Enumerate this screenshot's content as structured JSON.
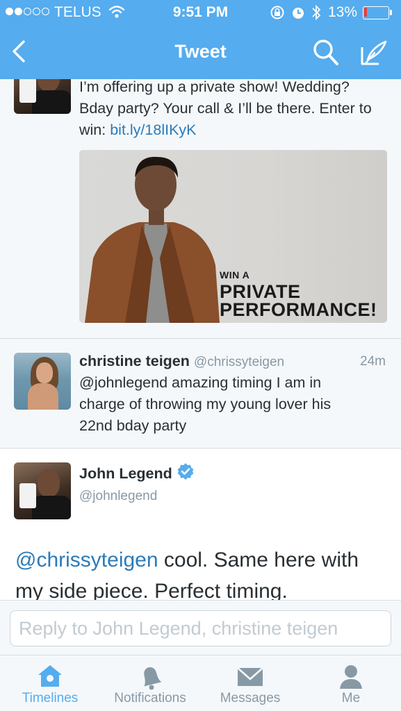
{
  "status_bar": {
    "carrier": "TELUS",
    "time": "9:51 PM",
    "battery_percent": "13%",
    "battery_level": 0.13,
    "signal_bars_filled": 2,
    "signal_bars_total": 5
  },
  "nav": {
    "title": "Tweet",
    "icons": [
      "back-chevron-icon",
      "search-icon",
      "compose-icon"
    ]
  },
  "tweets": [
    {
      "text_before_link": "I’m offering up a private show! Wedding? Bday party? Your call & I’ll be there. Enter to win: ",
      "link": "bit.ly/18lIKyK",
      "media": {
        "line1": "WIN A",
        "line2": "PRIVATE",
        "line3": "PERFORMANCE!"
      }
    },
    {
      "name": "christine teigen",
      "handle": "@chrissyteigen",
      "time": "24m",
      "text": "@johnlegend amazing timing I am in charge of throwing my young lover his 22nd bday party"
    },
    {
      "name": "John Legend",
      "handle": "@johnlegend",
      "mention": "@chrissyteigen",
      "text": " cool. Same here with my side piece. Perfect timing."
    }
  ],
  "reply": {
    "placeholder": "Reply to John Legend, christine teigen"
  },
  "tabs": [
    {
      "label": "Timelines",
      "icon": "home-icon",
      "active": true
    },
    {
      "label": "Notifications",
      "icon": "bell-icon",
      "active": false
    },
    {
      "label": "Messages",
      "icon": "envelope-icon",
      "active": false
    },
    {
      "label": "Me",
      "icon": "person-icon",
      "active": false
    }
  ],
  "colors": {
    "brand": "#55acee",
    "link": "#2b7bb9",
    "muted": "#8899a6",
    "battery_low": "#ff3b30"
  }
}
